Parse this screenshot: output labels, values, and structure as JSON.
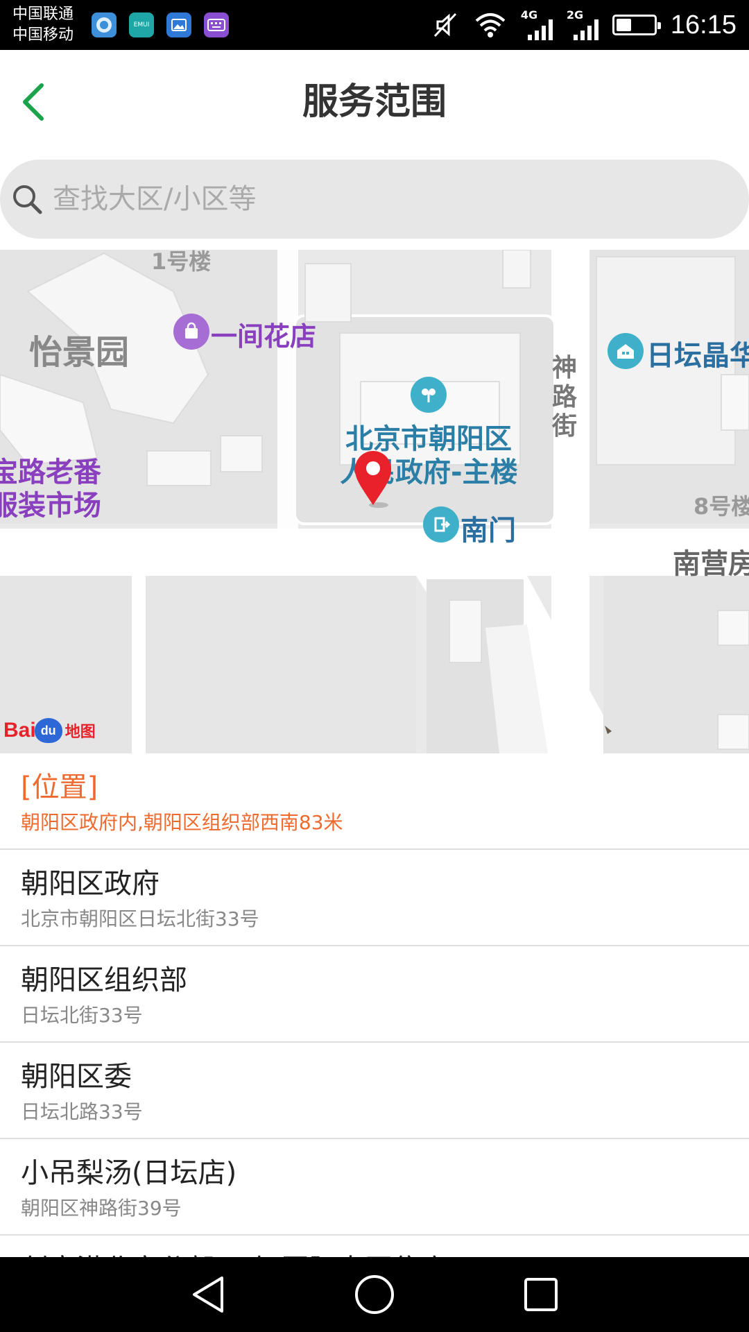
{
  "status_bar": {
    "carrier_1": "中国联通",
    "carrier_2": "中国移动",
    "net_1": "4G",
    "net_2": "2G",
    "battery_level": 0.4,
    "time": "16:15",
    "notification_icons": [
      "browser-icon",
      "emui-icon",
      "gallery-icon",
      "keyboard-icon"
    ],
    "emui_label": "EMUI"
  },
  "header": {
    "title": "服务范围",
    "accent_color": "#1aa34a"
  },
  "search": {
    "placeholder": "查找大区/小区等"
  },
  "map": {
    "labels": {
      "yijingyuan": "怡景园",
      "yijian_flower": "一间花店",
      "bldg_1": "1号楼",
      "ritan_jinghua": "日坛晶华",
      "shenlu_street": "神路街",
      "gov_line1": "北京市朝阳区",
      "gov_line2": "人民政府-主楼",
      "south_gate": "南门",
      "bldg_8": "8号楼",
      "nanyingfang": "南营房",
      "market_line1": "宝路老番",
      "market_line2": "服装市场"
    },
    "logo_bai": "Bai",
    "logo_du": "du",
    "logo_ditu": "地图",
    "marker_color": "#e8212b"
  },
  "list": {
    "items": [
      {
        "title": "[位置]",
        "subtitle": "朝阳区政府内,朝阳区组织部西南83米"
      },
      {
        "title": "朝阳区政府",
        "subtitle": "北京市朝阳区日坛北街33号"
      },
      {
        "title": "朝阳区组织部",
        "subtitle": "日坛北街33号"
      },
      {
        "title": "朝阳区委",
        "subtitle": "日坛北路33号"
      },
      {
        "title": "小吊梨汤(日坛店)",
        "subtitle": "朝阳区神路街39号"
      },
      {
        "title": "创意港北京分部(日坛国际中医住店)",
        "subtitle": ""
      }
    ]
  }
}
